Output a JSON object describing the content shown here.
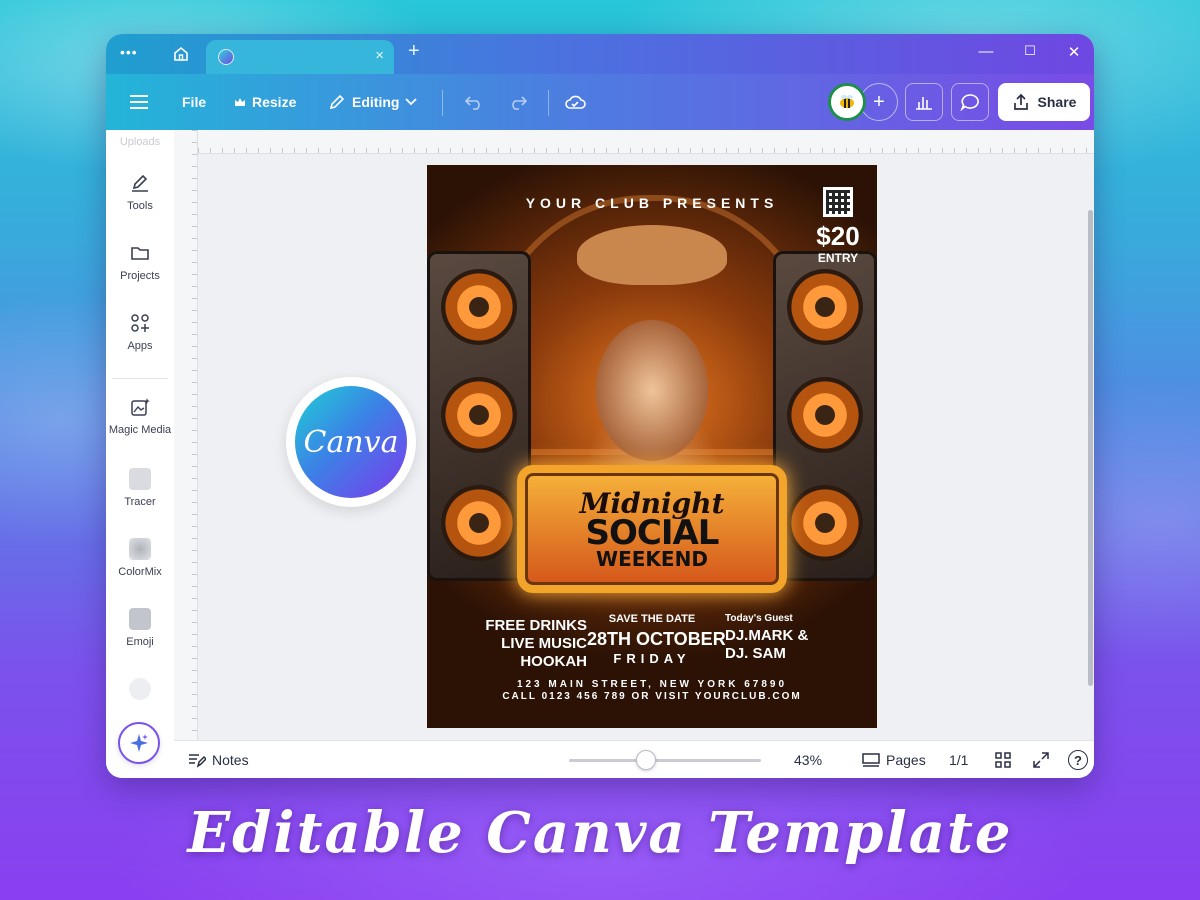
{
  "window": {
    "tab_close": "×",
    "tab_new": "+",
    "minimize": "—",
    "maximize": "☐",
    "close": "✕"
  },
  "toolbar": {
    "menu_icon": "hamburger-icon",
    "file_label": "File",
    "resize_label": "Resize",
    "editing_label": "Editing",
    "share_label": "Share"
  },
  "sidebar": {
    "items": [
      {
        "label": "Uploads"
      },
      {
        "label": "Tools"
      },
      {
        "label": "Projects"
      },
      {
        "label": "Apps"
      },
      {
        "label": "Magic Media"
      },
      {
        "label": "Tracer"
      },
      {
        "label": "ColorMix"
      },
      {
        "label": "Emoji"
      }
    ]
  },
  "logo": {
    "text": "Canva"
  },
  "flyer": {
    "presents": "YOUR CLUB PRESENTS",
    "price": "$20",
    "price_sub": "ENTRY",
    "title_script": "Midnight",
    "title_line1": "SOCIAL",
    "title_line2": "WEEKEND",
    "col1": [
      "FREE DRINKS",
      "LIVE MUSIC",
      "HOOKAH"
    ],
    "save_date": "SAVE THE DATE",
    "date": "28TH OCTOBER",
    "day": "FRIDAY",
    "guest_label": "Today's Guest",
    "guest1": "DJ.MARK &",
    "guest2": "DJ. SAM",
    "address": "123 MAIN STREET, NEW YORK 67890",
    "contact": "CALL 0123 456 789 OR VISIT YOURCLUB.COM"
  },
  "bottombar": {
    "notes_label": "Notes",
    "zoom": "43%",
    "zoom_level": 0.43,
    "pages_label": "Pages",
    "page_count": "1/1",
    "help": "?"
  },
  "caption": "Editable Canva Template",
  "colors": {
    "accent": "#7b52ec",
    "toolbar_start": "#23b5d8",
    "toolbar_end": "#7a4be6"
  }
}
